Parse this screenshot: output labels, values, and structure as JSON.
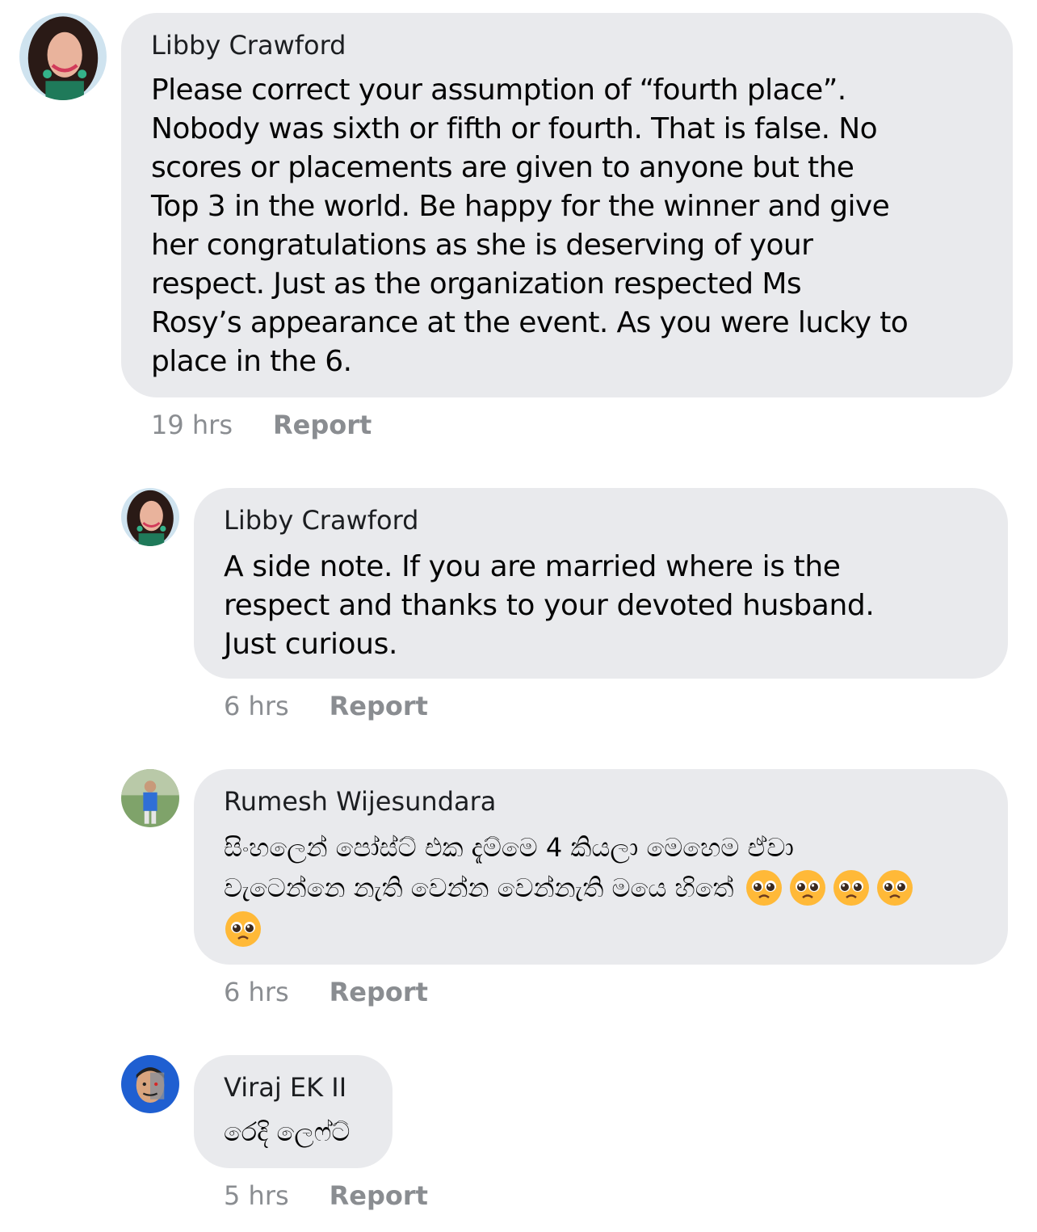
{
  "comments": [
    {
      "author": "Libby Crawford",
      "text": "Please correct your assumption of “fourth place”.\nNobody was sixth or fifth or fourth. That is false. No\nscores or placements are given to anyone but the\nTop 3 in the world. Be happy for the winner and give\nher congratulations as she is deserving of your\nrespect. Just as the organization respected Ms\nRosy’s appearance at the event. As you were lucky to\nplace in the 6.",
      "time": "19 hrs",
      "report_label": "Report"
    },
    {
      "author": "Libby Crawford",
      "text": "A side note. If you are married where is the\nrespect and thanks to your devoted husband.\nJust curious.",
      "time": "6 hrs",
      "report_label": "Report"
    },
    {
      "author": "Rumesh Wijesundara",
      "text_line1": "සිංහලෙන් පෝස්ට් එක දැම්මෙ 4 කියලා මෙහෙම ඒවා",
      "text_line2": "වැටෙන්නෙ නැති වෙන්න වෙන්නැති මයෙ හිතේ",
      "emoji": "pleading-face-emoji",
      "time": "6 hrs",
      "report_label": "Report"
    },
    {
      "author": "Viraj EK II",
      "text": "රෙදි ලෙෆ්ට්",
      "time": "5 hrs",
      "report_label": "Report"
    }
  ],
  "colors": {
    "bubble": "#e9eaed",
    "meta": "#8a8d91",
    "text": "#050505"
  }
}
